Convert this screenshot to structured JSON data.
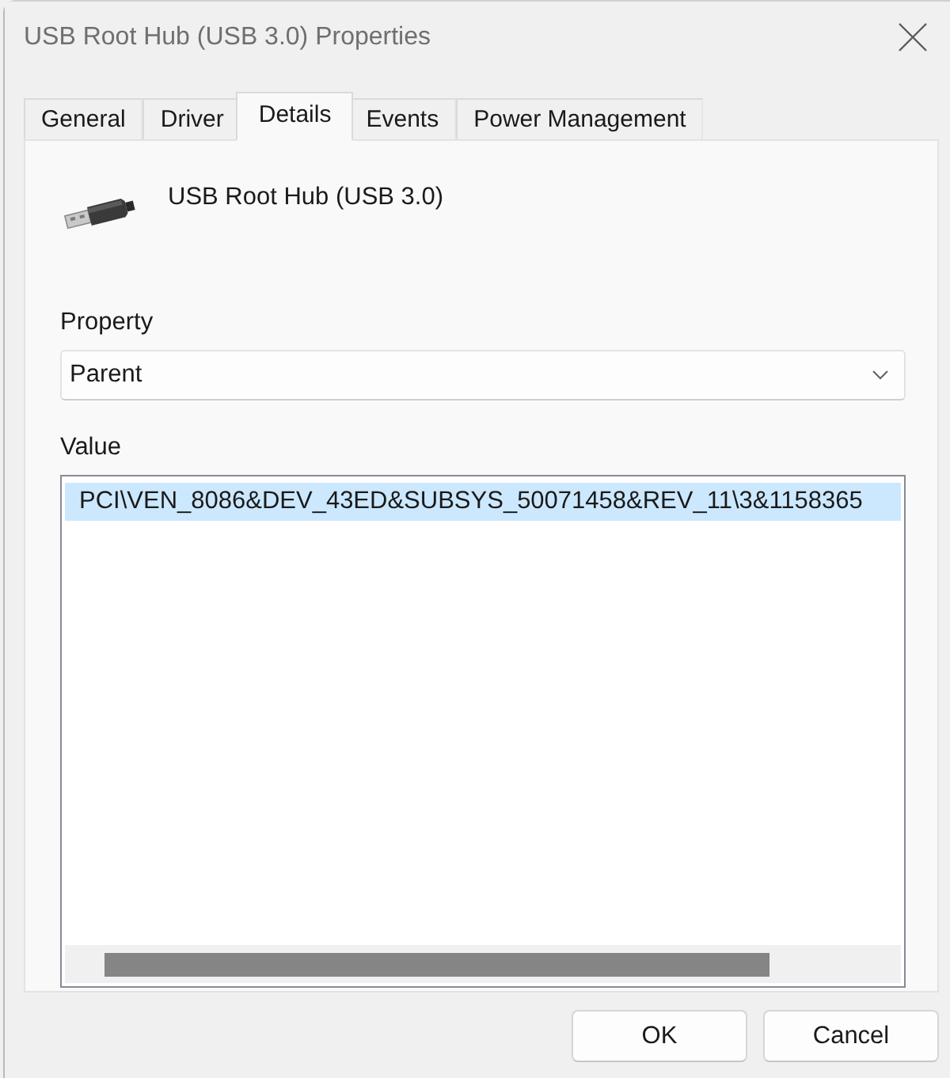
{
  "window": {
    "title": "USB Root Hub (USB 3.0) Properties"
  },
  "tabs": [
    {
      "label": "General",
      "selected": false
    },
    {
      "label": "Driver",
      "selected": false
    },
    {
      "label": "Details",
      "selected": true
    },
    {
      "label": "Events",
      "selected": false
    },
    {
      "label": "Power Management",
      "selected": false
    }
  ],
  "device": {
    "name": "USB Root Hub (USB 3.0)"
  },
  "property": {
    "label": "Property",
    "value": "Parent"
  },
  "value": {
    "label": "Value",
    "rows": [
      {
        "text": "PCI\\VEN_8086&DEV_43ED&SUBSYS_50071458&REV_11\\3&1158365",
        "selected": true
      }
    ]
  },
  "buttons": [
    "OK",
    "Cancel"
  ]
}
